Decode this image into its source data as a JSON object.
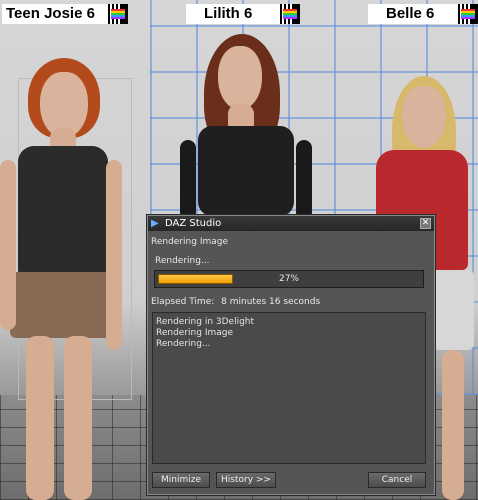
{
  "labels": {
    "left": "Teen Josie 6",
    "middle": "Lilith 6",
    "right": "Belle 6"
  },
  "dialog": {
    "title": "DAZ Studio",
    "heading": "Rendering Image",
    "status": "Rendering...",
    "progress_percent": 27,
    "progress_text": "27%",
    "elapsed_label": "Elapsed Time:",
    "elapsed_value": "8 minutes 16 seconds",
    "log": [
      "Rendering in 3Delight",
      "Rendering Image",
      "Rendering..."
    ],
    "buttons": {
      "minimize": "Minimize",
      "history": "History >>",
      "cancel": "Cancel"
    }
  },
  "colors": {
    "progress_fill": "#f0a000",
    "grid": "#5a8cdc"
  }
}
